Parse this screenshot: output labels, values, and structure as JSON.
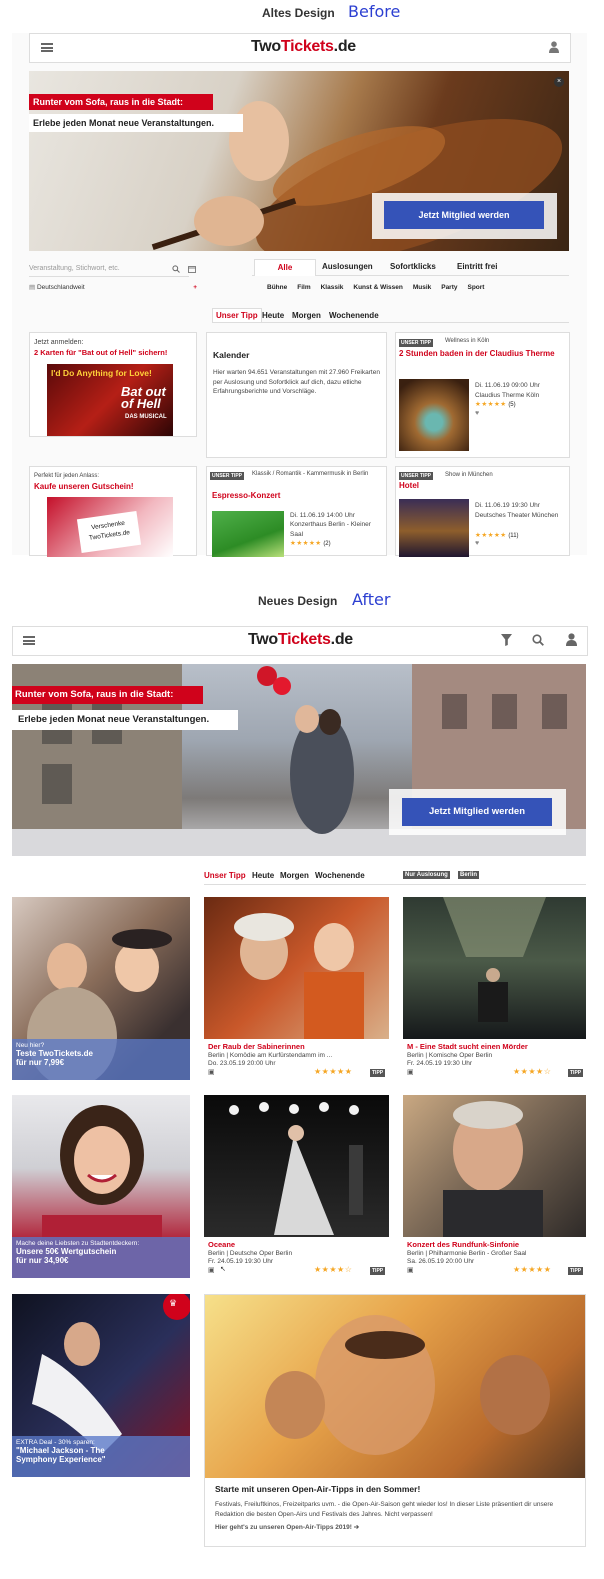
{
  "sections": {
    "before": {
      "title": "Altes Design",
      "tag": "Before"
    },
    "after": {
      "title": "Neues Design",
      "tag": "After"
    }
  },
  "logo": {
    "main": "Two",
    "accent": "Tickets",
    "suffix": ".de"
  },
  "hero": {
    "line1": "Runter vom Sofa, raus in die Stadt:",
    "line2": "Erlebe jeden Monat neue Veranstaltungen.",
    "cta": "Jetzt Mitglied werden"
  },
  "old": {
    "search_placeholder": "Veranstaltung, Stichwort, etc.",
    "location": "Deutschlandweit",
    "main_tabs": [
      "Alle",
      "Auslosungen",
      "Sofortklicks",
      "Eintritt frei"
    ],
    "cat_tabs": [
      "Bühne",
      "Film",
      "Klassik",
      "Kunst & Wissen",
      "Musik",
      "Party",
      "Sport"
    ],
    "time_tabs": [
      "Unser Tipp",
      "Heute",
      "Morgen",
      "Wochenende"
    ],
    "card1": {
      "kicker": "Jetzt anmelden:",
      "title": "2 Karten für \"Bat out of Hell\" sichern!",
      "img_text1": "I'd Do Anything for Love!",
      "img_text2": "Bat out of Hell",
      "img_text3": "DAS MUSICAL"
    },
    "card2": {
      "title": "Kalender",
      "text": "Hier warten 94.651 Veranstaltungen mit 27.960 Freikarten per Auslosung und Sofortklick auf dich, dazu etliche Erfahrungsberichte und Vorschläge."
    },
    "card3": {
      "tag": "UNSER TIPP",
      "kicker": "Wellness in Köln",
      "title": "2 Stunden baden in der Claudius Therme",
      "date": "Di. 11.06.19 09:00 Uhr",
      "venue": "Claudius Therme Köln",
      "rating": "(5)"
    },
    "card4": {
      "kicker": "Perfekt für jeden Anlass:",
      "title": "Kaufe unseren Gutschein!",
      "img_text": "Verschenke TwoTickets.de"
    },
    "card5": {
      "tag": "UNSER TIPP",
      "kicker": "Klassik / Romantik - Kammermusik in Berlin",
      "title": "Espresso-Konzert",
      "date": "Di. 11.06.19 14:00 Uhr",
      "venue": "Konzerthaus Berlin - Kleiner Saal",
      "rating": "(2)"
    },
    "card6": {
      "tag": "UNSER TIPP",
      "kicker": "Show in München",
      "title": "Hotel",
      "date": "Di. 11.06.19 19:30 Uhr",
      "venue": "Deutsches Theater München",
      "rating": "(11)"
    }
  },
  "new": {
    "time_tabs": [
      "Unser Tipp",
      "Heute",
      "Morgen",
      "Wochenende"
    ],
    "filter_tags": [
      "Nur Auslosung",
      "Berlin"
    ],
    "promo1": {
      "line1": "Neu hier?",
      "line2": "Teste TwoTickets.de",
      "line3": "für nur 7,99€"
    },
    "promo2": {
      "line1": "Mache deine Liebsten zu Stadtentdeckern:",
      "line2": "Unsere 50€ Wertgutschein",
      "line3": "für nur 34,90€"
    },
    "promo3": {
      "line1": "EXTRA Deal - 30% sparen:",
      "line2": "\"Michael Jackson - The",
      "line3": "Symphony Experience\""
    },
    "events": [
      {
        "title": "Der Raub der Sabinerinnen",
        "venue": "Berlin | Komödie am Kurfürstendamm im ...",
        "date": "Do. 23.05.19 20:00 Uhr",
        "stars": "★★★★★",
        "tag": "TIPP"
      },
      {
        "title": "M - Eine Stadt sucht einen Mörder",
        "venue": "Berlin | Komische Oper Berlin",
        "date": "Fr. 24.05.19 19:30 Uhr",
        "stars": "★★★★☆",
        "tag": "TIPP"
      },
      {
        "title": "Oceane",
        "venue": "Berlin | Deutsche Oper Berlin",
        "date": "Fr. 24.05.19 19:30 Uhr",
        "stars": "★★★★☆",
        "tag": "TIPP"
      },
      {
        "title": "Konzert des Rundfunk-Sinfonie",
        "venue": "Berlin | Philharmonie Berlin - Großer Saal",
        "date": "Sa. 26.05.19 20:00 Uhr",
        "stars": "★★★★★",
        "tag": "TIPP"
      }
    ],
    "feature": {
      "title": "Starte mit unseren Open-Air-Tipps in den Sommer!",
      "text": "Festivals, Freiluftkinos, Freizeitparks uvm. - die Open-Air-Saison geht wieder los! In dieser Liste präsentiert dir unsere Redaktion die besten Open-Airs und Festivals des Jahres. Nicht verpassen!",
      "link": "Hier geht's zu unseren Open-Air-Tipps 2019!"
    }
  }
}
